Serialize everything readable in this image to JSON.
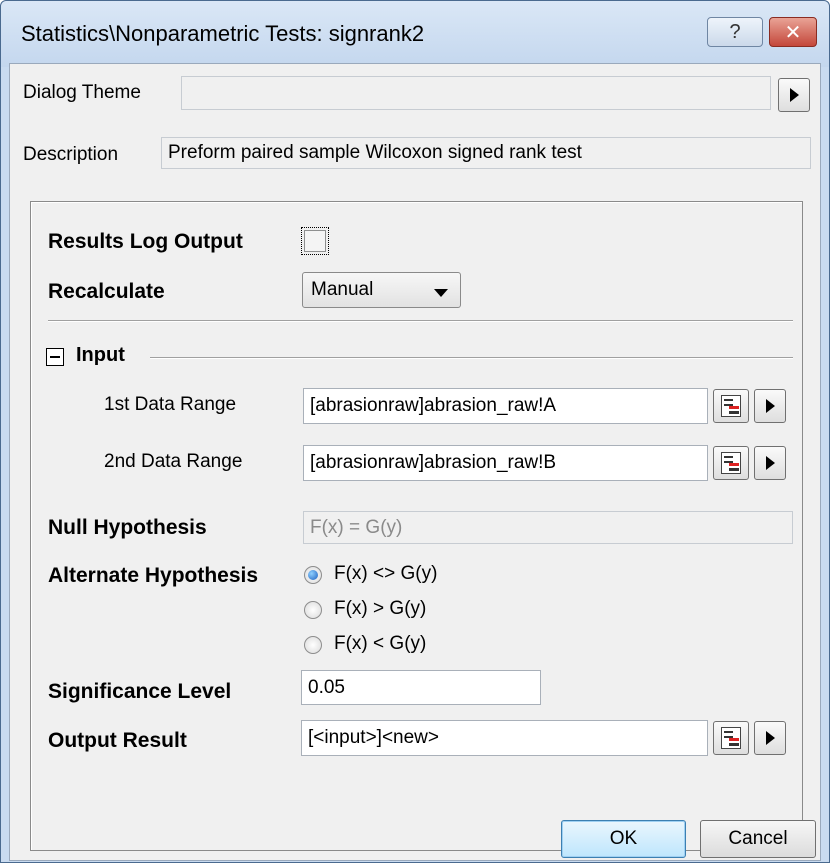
{
  "window": {
    "title": "Statistics\\Nonparametric Tests: signrank2",
    "help_icon": "question-mark",
    "close_icon": "x"
  },
  "dialog_theme": {
    "label": "Dialog Theme",
    "value": ""
  },
  "description": {
    "label": "Description",
    "value": "Preform paired sample Wilcoxon signed rank test"
  },
  "results_log": {
    "label": "Results Log Output",
    "checked": false
  },
  "recalculate": {
    "label": "Recalculate",
    "value": "Manual"
  },
  "input": {
    "header": "Input",
    "range1": {
      "label": "1st Data Range",
      "value": "[abrasionraw]abrasion_raw!A"
    },
    "range2": {
      "label": "2nd Data Range",
      "value": "[abrasionraw]abrasion_raw!B"
    }
  },
  "null_hypothesis": {
    "label": "Null Hypothesis",
    "value": "F(x) = G(y)"
  },
  "alternate_hypothesis": {
    "label": "Alternate Hypothesis",
    "options": [
      "F(x) <> G(y)",
      "F(x) > G(y)",
      "F(x) < G(y)"
    ],
    "selected": 0
  },
  "significance": {
    "label": "Significance Level",
    "value": "0.05"
  },
  "output_result": {
    "label": "Output Result",
    "value": "[<input>]<new>"
  },
  "buttons": {
    "ok": "OK",
    "cancel": "Cancel"
  }
}
